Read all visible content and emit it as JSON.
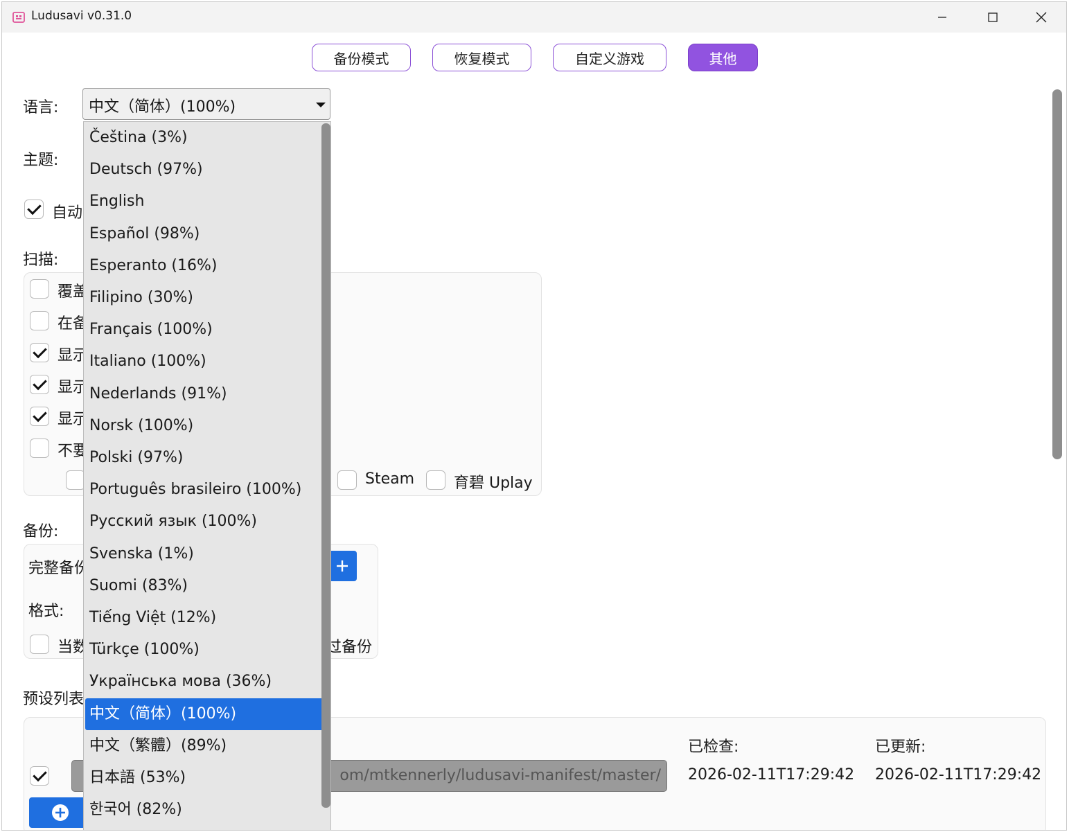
{
  "window": {
    "title": "Ludusavi v0.31.0"
  },
  "nav": {
    "backup": "备份模式",
    "restore": "恢复模式",
    "custom": "自定义游戏",
    "other": "其他"
  },
  "settings": {
    "language_label": "语言:",
    "language_value": "中文（简体）(100%)",
    "theme_label": "主题:",
    "auto_label": "自动",
    "scan_label": "扫描:",
    "scan_rows": [
      "覆盖",
      "在备",
      "显示",
      "显示",
      "显示",
      "不要"
    ],
    "store_steam": "Steam",
    "store_uplay": "育碧 Uplay",
    "backup_label": "备份:",
    "full_backup_label": "完整备份",
    "format_label": "格式:",
    "when_label": "当数",
    "skip_backup_label": "过备份",
    "manifest_label": "预设列表",
    "checked_label": "已检查:",
    "updated_label": "已更新:",
    "manifest_url": "om/mtkennerly/ludusavi-manifest/master/",
    "checked_time": "2026-02-11T17:29:42",
    "updated_time": "2026-02-11T17:29:42"
  },
  "dropdown": {
    "items": [
      "Čeština (3%)",
      "Deutsch (97%)",
      "English",
      "Español (98%)",
      "Esperanto (16%)",
      "Filipino (30%)",
      "Français (100%)",
      "Italiano (100%)",
      "Nederlands (91%)",
      "Norsk (100%)",
      "Polski (97%)",
      "Português brasileiro (100%)",
      "Русский язык (100%)",
      "Svenska (1%)",
      "Suomi (83%)",
      "Tiếng Việt (12%)",
      "Türkçe (100%)",
      "Українська мова (36%)",
      "中文（简体）(100%)",
      "中文（繁體）(89%)",
      "日本語 (53%)",
      "한국어 (82%)"
    ],
    "selected_index": 18
  },
  "colors": {
    "accent": "#9153e0",
    "selection": "#1f6fe0"
  }
}
